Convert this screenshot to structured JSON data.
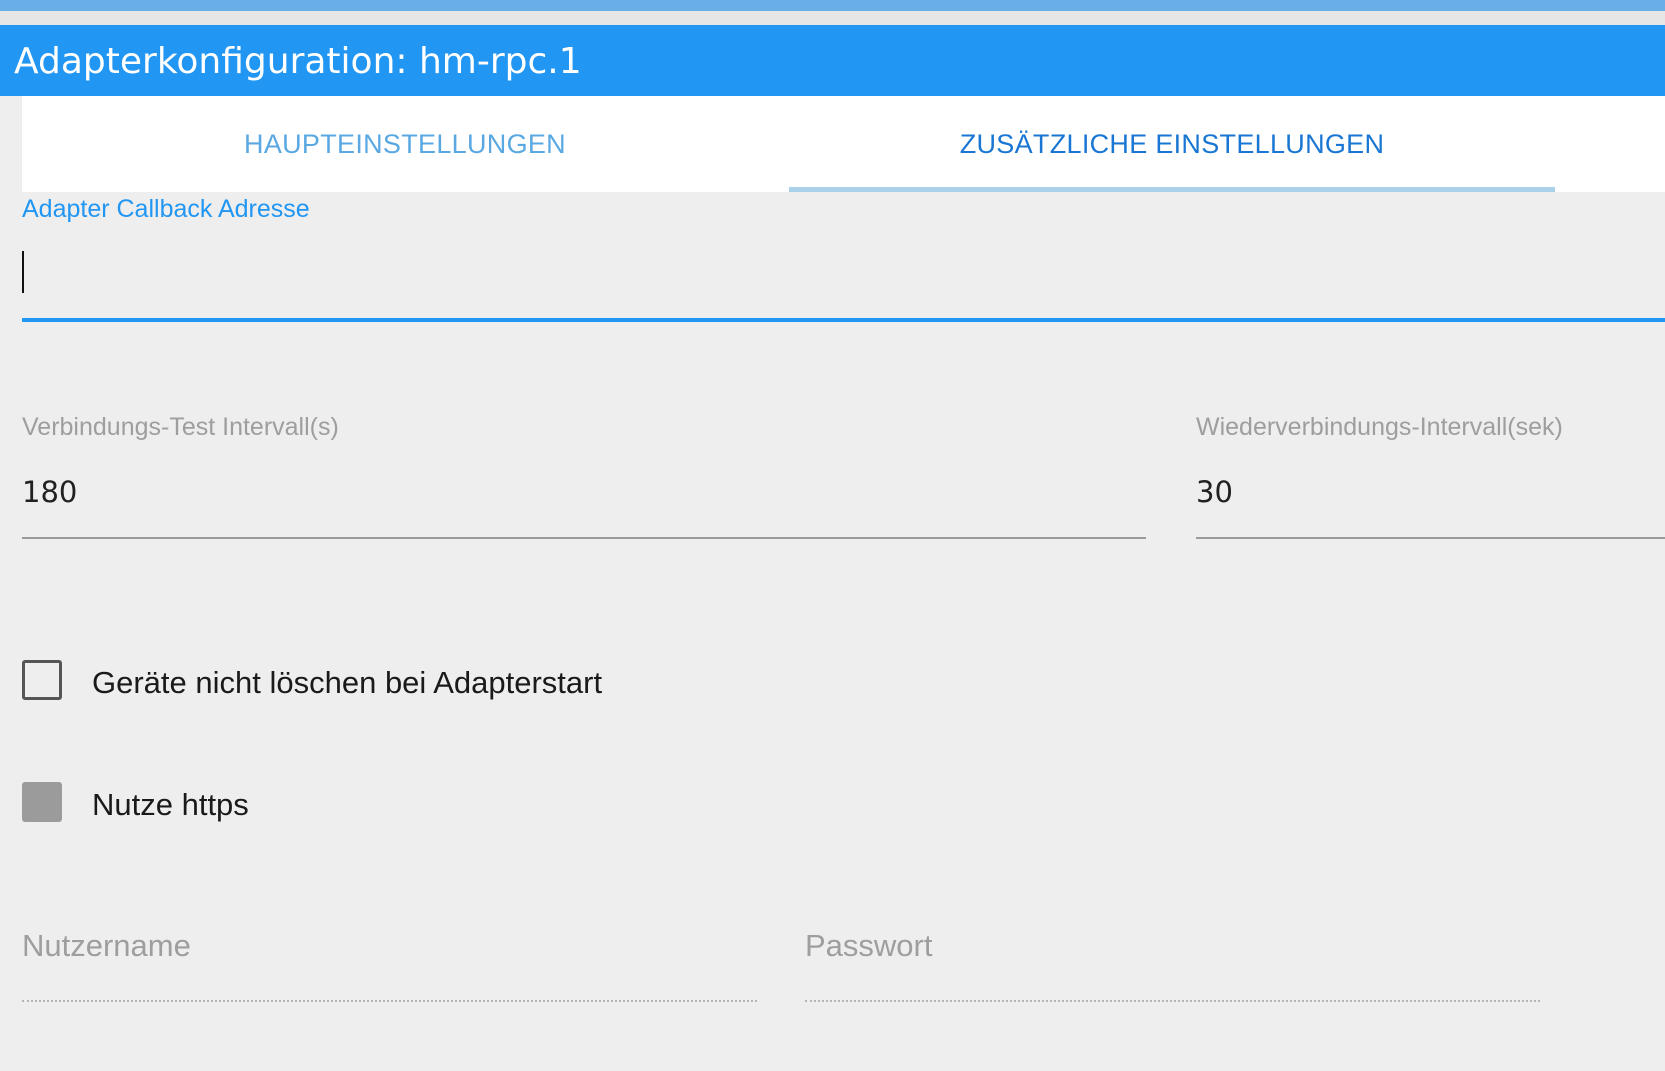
{
  "window": {
    "title": "Adapterkonfiguration: hm-rpc.1"
  },
  "tabs": [
    {
      "label": "HAUPTEINSTELLUNGEN",
      "active": false
    },
    {
      "label": "ZUSÄTZLICHE EINSTELLUNGEN",
      "active": true
    }
  ],
  "fields": {
    "callback": {
      "label": "Adapter Callback Adresse",
      "value": ""
    },
    "test_interval": {
      "label": "Verbindungs-Test Intervall(s)",
      "value": "180"
    },
    "reconnect_interval": {
      "label": "Wiederverbindungs-Intervall(sek)",
      "value": "30"
    },
    "username": {
      "label": "Nutzername",
      "value": ""
    },
    "password": {
      "label": "Passwort",
      "value": ""
    }
  },
  "checkboxes": {
    "dont_delete": {
      "label": "Geräte nicht löschen bei Adapterstart",
      "checked": false
    },
    "use_https": {
      "label": "Nutze https",
      "checked": false
    }
  },
  "colors": {
    "accent": "#2196f3",
    "active_tab_text": "#1976d2",
    "inactive_tab_text": "#5aa8e2",
    "background": "#eeeeee"
  }
}
